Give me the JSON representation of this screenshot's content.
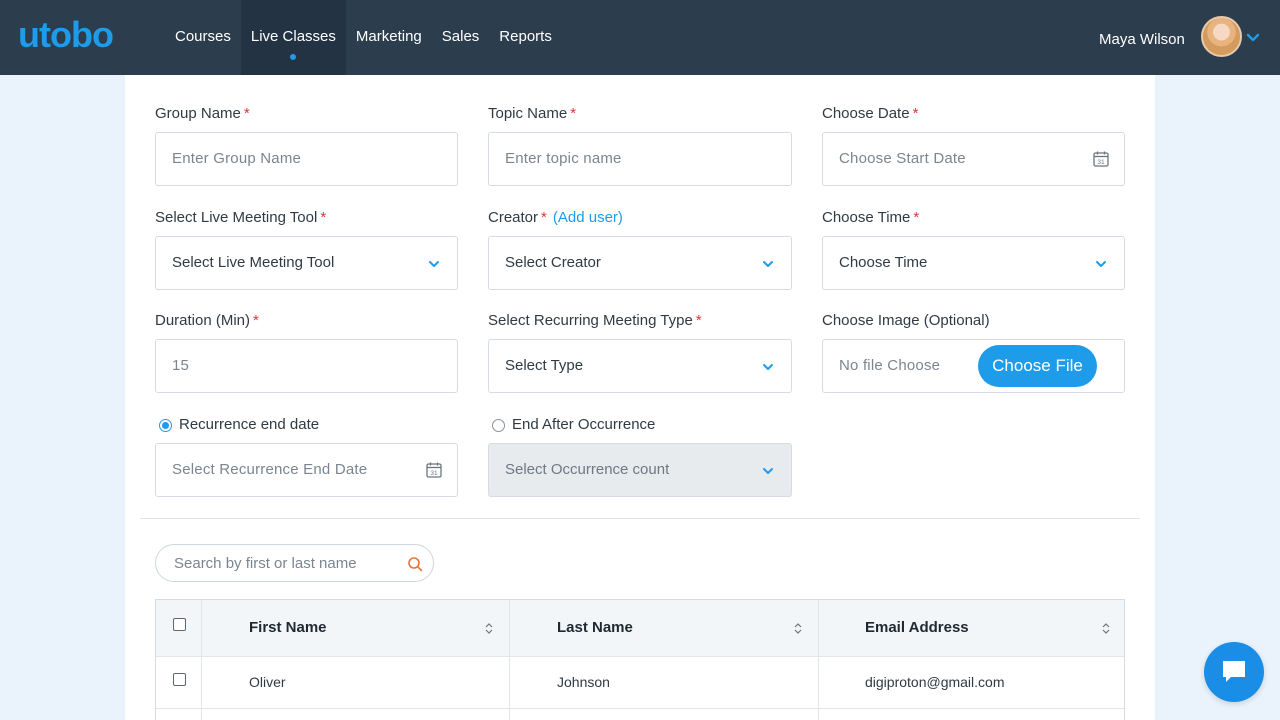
{
  "brand": {
    "logo_text": "utobo"
  },
  "nav": {
    "items": [
      {
        "label": "Courses"
      },
      {
        "label": "Live Classes",
        "active": true
      },
      {
        "label": "Marketing"
      },
      {
        "label": "Sales"
      },
      {
        "label": "Reports"
      }
    ]
  },
  "user": {
    "name": "Maya Wilson"
  },
  "form": {
    "group_name": {
      "label": "Group Name",
      "required": "*",
      "placeholder": "Enter Group Name"
    },
    "topic_name": {
      "label": "Topic Name",
      "required": "*",
      "placeholder": "Enter topic name"
    },
    "choose_date": {
      "label": "Choose Date",
      "required": "*",
      "placeholder": "Choose Start Date"
    },
    "meeting_tool": {
      "label": "Select Live Meeting Tool",
      "required": "*",
      "value": "Select Live Meeting Tool"
    },
    "creator": {
      "label": "Creator",
      "required": "*",
      "add_user": "(Add user)",
      "value": "Select Creator"
    },
    "choose_time": {
      "label": "Choose Time",
      "required": "*",
      "value": "Choose Time"
    },
    "duration": {
      "label": "Duration (Min)",
      "required": "*",
      "value": "15"
    },
    "recurring_type": {
      "label": "Select Recurring Meeting Type",
      "required": "*",
      "value": "Select Type"
    },
    "image": {
      "label": "Choose Image (Optional)",
      "status": "No file Choose",
      "button": "Choose File"
    },
    "recurrence_end": {
      "label": "Recurrence end date",
      "selected": true,
      "placeholder": "Select Recurrence End Date"
    },
    "end_after": {
      "label": "End After Occurrence",
      "selected": false,
      "value": "Select Occurrence count"
    }
  },
  "search": {
    "placeholder": "Search by first or last name"
  },
  "table": {
    "columns": [
      "First Name",
      "Last Name",
      "Email Address"
    ],
    "rows": [
      {
        "first": "Oliver",
        "last": "Johnson",
        "email": "digiproton@gmail.com"
      }
    ]
  },
  "colors": {
    "accent": "#1e9be9",
    "nav_bg": "#2c3d4e",
    "required": "#e0363c"
  },
  "icons": {
    "calendar": "calendar-icon",
    "chevron": "chevron-down-icon",
    "search": "search-icon",
    "chat": "chat-icon"
  }
}
